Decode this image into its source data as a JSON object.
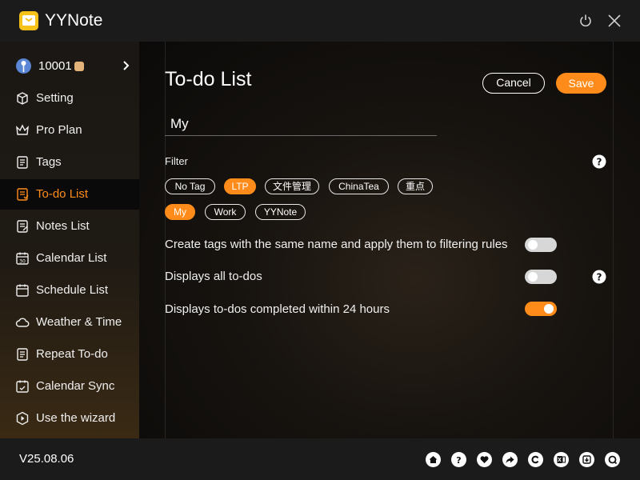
{
  "app": {
    "title": "YYNote"
  },
  "user": {
    "id": "10001"
  },
  "sidebar": {
    "items": [
      {
        "label": "Setting",
        "icon": "cube-icon"
      },
      {
        "label": "Pro Plan",
        "icon": "crown-icon"
      },
      {
        "label": "Tags",
        "icon": "document-icon"
      },
      {
        "label": "To-do List",
        "icon": "todo-icon",
        "active": true
      },
      {
        "label": "Notes List",
        "icon": "notes-icon"
      },
      {
        "label": "Calendar List",
        "icon": "calendar-icon"
      },
      {
        "label": "Schedule List",
        "icon": "schedule-icon"
      },
      {
        "label": "Weather & Time",
        "icon": "cloud-icon"
      },
      {
        "label": "Repeat To-do",
        "icon": "repeat-icon"
      },
      {
        "label": "Calendar Sync",
        "icon": "sync-icon"
      },
      {
        "label": "Use the wizard",
        "icon": "wizard-icon"
      }
    ]
  },
  "main": {
    "title": "To-do List",
    "cancel_label": "Cancel",
    "save_label": "Save",
    "name_value": "My",
    "filter_label": "Filter",
    "tags": [
      {
        "label": "No Tag",
        "selected": false
      },
      {
        "label": "LTP",
        "selected": true
      },
      {
        "label": "文件管理",
        "selected": false
      },
      {
        "label": "ChinaTea",
        "selected": false
      },
      {
        "label": "重点",
        "selected": false
      },
      {
        "label": "My",
        "selected": true
      },
      {
        "label": "Work",
        "selected": false
      },
      {
        "label": "YYNote",
        "selected": false
      }
    ],
    "options": [
      {
        "label": "Create tags with the same name and apply them to filtering rules",
        "enabled": false
      },
      {
        "label": "Displays all to-dos",
        "enabled": false
      },
      {
        "label": "Displays to-dos completed within 24 hours",
        "enabled": true
      }
    ]
  },
  "footer": {
    "version": "V25.08.06",
    "icons": [
      "home-icon",
      "help-icon",
      "heart-icon",
      "share-icon",
      "copyright-icon",
      "excel-icon",
      "download-icon",
      "support-icon"
    ]
  },
  "colors": {
    "accent": "#ff8c1a",
    "background": "#0f0f0f",
    "bar": "#1b1b1b"
  }
}
